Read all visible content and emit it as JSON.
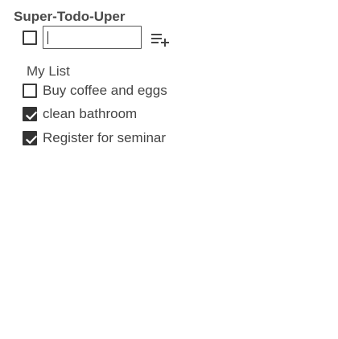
{
  "app": {
    "title": "Super-Todo-Uper"
  },
  "new_todo": {
    "checked": false,
    "input_value": "",
    "add_icon": "playlist-add-icon"
  },
  "list": {
    "title": "My List",
    "items": [
      {
        "label": "Buy coffee and eggs",
        "checked": false
      },
      {
        "label": "clean bathroom",
        "checked": true
      },
      {
        "label": "Register for seminar",
        "checked": true
      }
    ]
  },
  "colors": {
    "text": "#444444",
    "checkbox": "#333333",
    "background": "#ffffff"
  }
}
